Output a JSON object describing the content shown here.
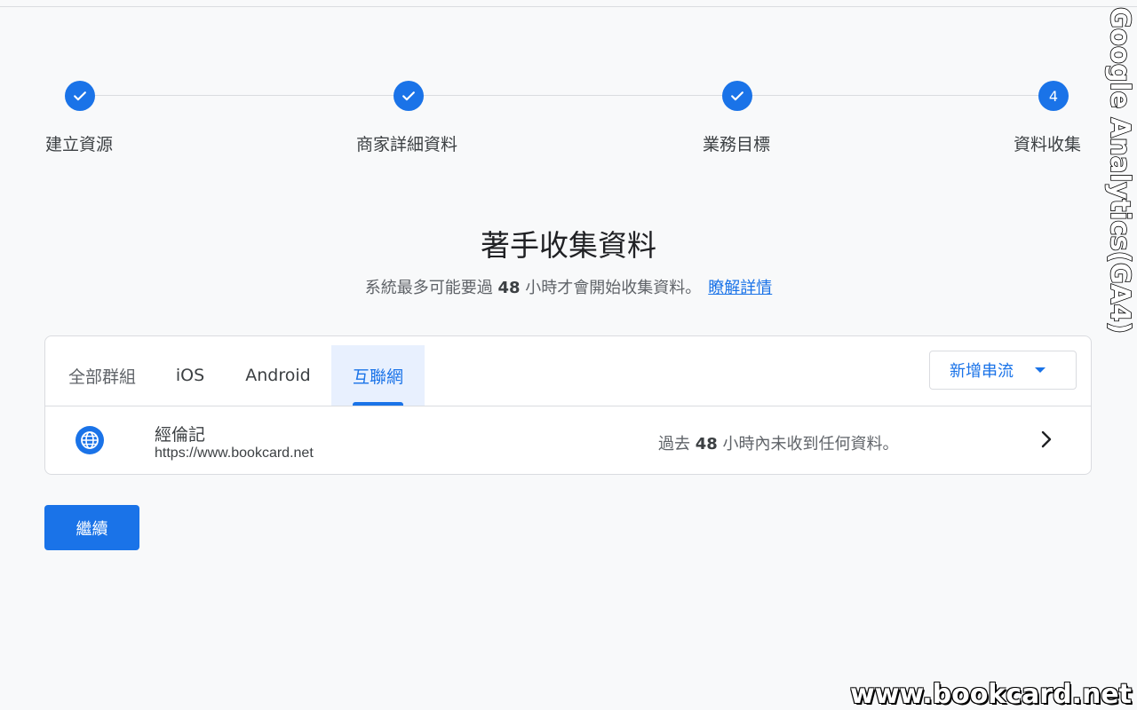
{
  "stepper": {
    "steps": [
      {
        "label": "建立資源",
        "state": "done"
      },
      {
        "label": "商家詳細資料",
        "state": "done"
      },
      {
        "label": "業務目標",
        "state": "done"
      },
      {
        "label": "資料收集",
        "state": "current",
        "number": "4"
      }
    ]
  },
  "header": {
    "title": "著手收集資料",
    "subtitle_pre": "系統最多可能要過",
    "subtitle_hours": "48",
    "subtitle_post": "小時才會開始收集資料。",
    "learn_more": "瞭解詳情"
  },
  "card": {
    "tabs": [
      {
        "label": "全部群組"
      },
      {
        "label": "iOS"
      },
      {
        "label": "Android"
      },
      {
        "label": "互聯網",
        "active": true
      }
    ],
    "add_stream_label": "新增串流",
    "stream": {
      "name": "經倫記",
      "url": "https://www.bookcard.net",
      "status_pre": "過去",
      "status_hours": "48",
      "status_post": "小時內未收到任何資料。",
      "icon": "globe-icon"
    }
  },
  "continue_label": "繼續",
  "watermarks": {
    "vertical": "Google Analytics(GA4)",
    "bottom": "www.bookcard.net"
  },
  "colors": {
    "accent": "#1a73e8",
    "background": "#f8f9fa"
  }
}
